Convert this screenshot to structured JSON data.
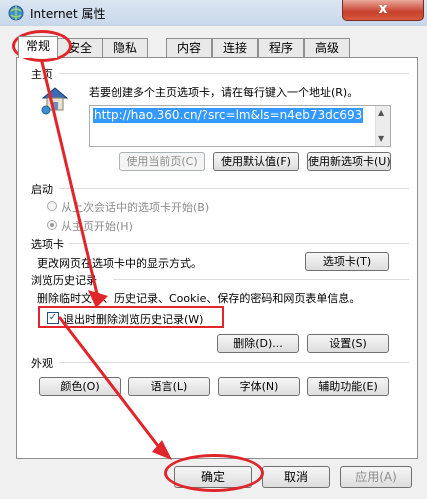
{
  "window": {
    "title": "Internet 属性",
    "close_label": "x"
  },
  "tabs": [
    {
      "label": "常规",
      "active": true
    },
    {
      "label": "安全"
    },
    {
      "label": "隐私"
    },
    {
      "label": "内容"
    },
    {
      "label": "连接"
    },
    {
      "label": "程序"
    },
    {
      "label": "高级"
    }
  ],
  "homepage": {
    "heading": "主页",
    "instruction": "若要创建多个主页选项卡，请在每行键入一个地址(R)。",
    "url": "http://hao.360.cn/?src=lm&ls=n4eb73dc693",
    "btn_use_current": "使用当前页(C)",
    "btn_use_default": "使用默认值(F)",
    "btn_use_new_tab": "使用新选项卡(U)"
  },
  "startup": {
    "heading": "启动",
    "option_last_session": "从上次会话中的选项卡开始(B)",
    "option_homepage": "从主页开始(H)"
  },
  "tabs_section": {
    "heading": "选项卡",
    "description": "更改网页在选项卡中的显示方式。",
    "btn_tabs": "选项卡(T)"
  },
  "history": {
    "heading": "浏览历史记录",
    "description": "删除临时文件、历史记录、Cookie、保存的密码和网页表单信息。",
    "checkbox_label": "退出时删除浏览历史记录(W)",
    "checkbox_checked": true,
    "btn_delete": "删除(D)...",
    "btn_settings": "设置(S)"
  },
  "appearance": {
    "heading": "外观",
    "btn_colors": "颜色(O)",
    "btn_languages": "语言(L)",
    "btn_fonts": "字体(N)",
    "btn_accessibility": "辅助功能(E)"
  },
  "footer": {
    "btn_ok": "确定",
    "btn_cancel": "取消",
    "btn_apply": "应用(A)"
  },
  "colors": {
    "annotation_red": "#e0262a",
    "selection_blue": "#3399ff"
  }
}
